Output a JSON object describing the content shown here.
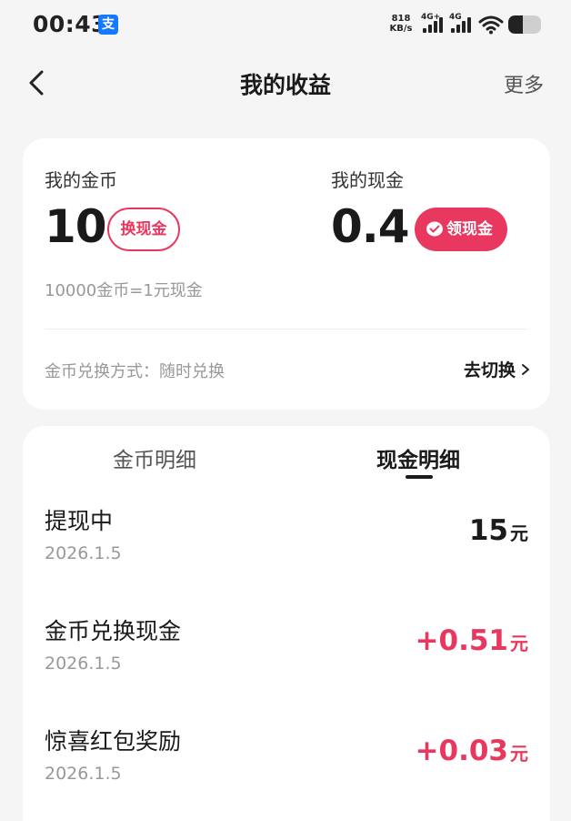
{
  "status_bar": {
    "time": "00:43",
    "alipay_badge": "支",
    "net_speed_value": "818",
    "net_speed_unit": "KB/s",
    "signal1_label": "4G+",
    "signal2_label": "4G",
    "battery_level": 0.45
  },
  "nav": {
    "title": "我的收益",
    "more_label": "更多"
  },
  "summary": {
    "coins_label": "我的金币",
    "coins_value": "10",
    "exchange_button": "换现金",
    "cash_label": "我的现金",
    "cash_value": "0.4",
    "claim_button": "领现金",
    "rate_text": "10000金币=1元现金",
    "method_text": "金币兑换方式：随时兑换",
    "switch_link": "去切换"
  },
  "tabs": {
    "coins": "金币明细",
    "cash": "现金明细",
    "active": "cash"
  },
  "records": [
    {
      "title": "提现中",
      "date": "2026.1.5",
      "amount": "15",
      "unit": "元",
      "positive": false
    },
    {
      "title": "金币兑换现金",
      "date": "2026.1.5",
      "amount": "+0.51",
      "unit": "元",
      "positive": true
    },
    {
      "title": "惊喜红包奖励",
      "date": "2026.1.5",
      "amount": "+0.03",
      "unit": "元",
      "positive": true
    }
  ],
  "colors": {
    "accent": "#e8385f",
    "background": "#f5f5f5",
    "card": "#ffffff",
    "alipay_blue": "#1677ff"
  }
}
